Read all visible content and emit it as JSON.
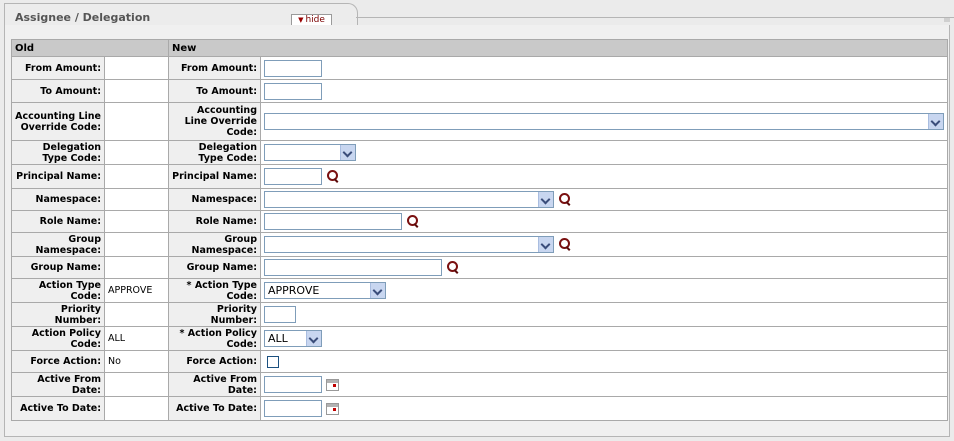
{
  "section": {
    "title": "Assignee / Delegation",
    "hide_label": "hide"
  },
  "columns": {
    "old": "Old",
    "new": "New"
  },
  "rows": [
    {
      "old_label": "From Amount:",
      "old_value": "",
      "new_label": "From Amount:",
      "control": "text",
      "value": ""
    },
    {
      "old_label": "To Amount:",
      "old_value": "",
      "new_label": "To Amount:",
      "control": "text",
      "value": ""
    },
    {
      "old_label": "Accounting Line Override Code:",
      "old_value": "",
      "new_label": "Accounting Line Override Code:",
      "control": "select",
      "value": ""
    },
    {
      "old_label": "Delegation Type Code:",
      "old_value": "",
      "new_label": "Delegation Type Code:",
      "control": "select",
      "value": ""
    },
    {
      "old_label": "Principal Name:",
      "old_value": "",
      "new_label": "Principal Name:",
      "control": "text-lookup",
      "value": ""
    },
    {
      "old_label": "Namespace:",
      "old_value": "",
      "new_label": "Namespace:",
      "control": "select-lookup",
      "value": ""
    },
    {
      "old_label": "Role Name:",
      "old_value": "",
      "new_label": "Role Name:",
      "control": "text-lookup",
      "value": ""
    },
    {
      "old_label": "Group Namespace:",
      "old_value": "",
      "new_label": "Group Namespace:",
      "control": "select-lookup",
      "value": ""
    },
    {
      "old_label": "Group Name:",
      "old_value": "",
      "new_label": "Group Name:",
      "control": "text-lookup",
      "value": ""
    },
    {
      "old_label": "Action Type Code:",
      "old_value": "APPROVE",
      "new_label": "* Action Type Code:",
      "control": "select",
      "value": "APPROVE"
    },
    {
      "old_label": "Priority Number:",
      "old_value": "",
      "new_label": "Priority Number:",
      "control": "text",
      "value": ""
    },
    {
      "old_label": "Action Policy Code:",
      "old_value": "ALL",
      "new_label": "* Action Policy Code:",
      "control": "select",
      "value": "ALL"
    },
    {
      "old_label": "Force Action:",
      "old_value": "No",
      "new_label": "Force Action:",
      "control": "checkbox",
      "value": ""
    },
    {
      "old_label": "Active From Date:",
      "old_value": "",
      "new_label": "Active From Date:",
      "control": "date",
      "value": ""
    },
    {
      "old_label": "Active To Date:",
      "old_value": "",
      "new_label": "Active To Date:",
      "control": "date",
      "value": ""
    }
  ]
}
